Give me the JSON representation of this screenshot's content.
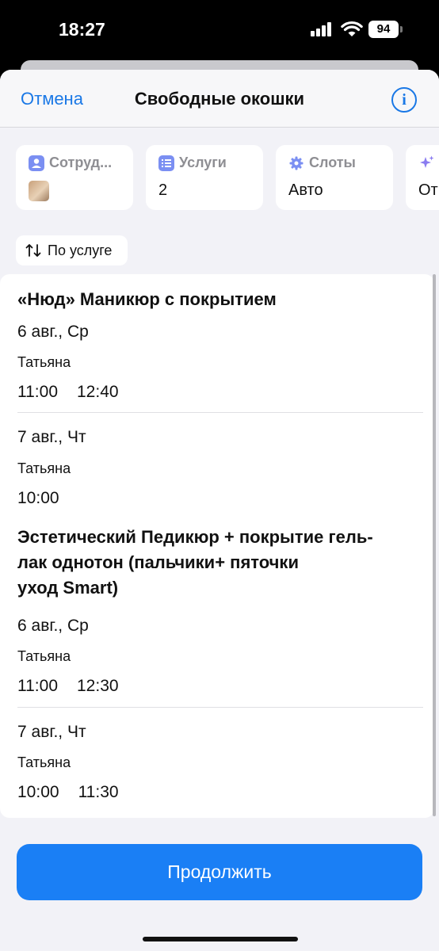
{
  "status_bar": {
    "time": "18:27",
    "battery": "94"
  },
  "nav": {
    "cancel": "Отмена",
    "title": "Свободные окошки",
    "info": "i"
  },
  "filters": [
    {
      "label": "Сотруд...",
      "value": ""
    },
    {
      "label": "Услуги",
      "value": "2"
    },
    {
      "label": "Слоты",
      "value": "Авто"
    },
    {
      "label": "",
      "value": "От"
    }
  ],
  "sort": {
    "label": "По услуге"
  },
  "services": [
    {
      "title": "«Нюд» Маникюр с покрытием",
      "days": [
        {
          "date": "6 авг., Ср",
          "staff": "Татьяна",
          "slots": [
            "11:00",
            "12:40"
          ]
        },
        {
          "date": "7 авг., Чт",
          "staff": "Татьяна",
          "slots": [
            "10:00"
          ]
        }
      ]
    },
    {
      "title_lines": [
        "Эстетический Педикюр + покрытие гель-",
        "лак однотон (пальчики+ пяточки",
        "уход Smart)"
      ],
      "days": [
        {
          "date": "6 авг., Ср",
          "staff": "Татьяна",
          "slots": [
            "11:00",
            "12:30"
          ]
        },
        {
          "date": "7 авг., Чт",
          "staff": "Татьяна",
          "slots": [
            "10:00",
            "11:30"
          ]
        }
      ]
    }
  ],
  "continue_label": "Продолжить",
  "colors": {
    "accent": "#1a78e6",
    "button": "#1a7ff5",
    "background": "#f2f2f7"
  }
}
